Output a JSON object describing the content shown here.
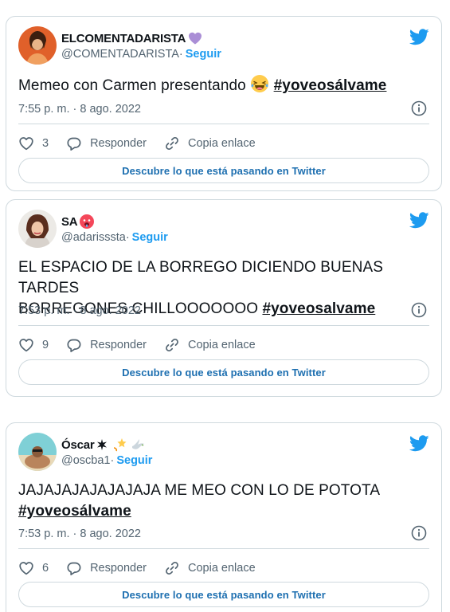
{
  "tweets": [
    {
      "display_name": "ELCOMENTADARISTA",
      "handle": "@COMENTADARISTA",
      "separator": " · ",
      "follow_label": "Seguir",
      "text": "Memeo con Carmen presentando ",
      "hashtag": "#yoveosálvame",
      "timestamp": "7:55 p. m. · 8 ago. 2022",
      "likes": "3",
      "reply_label": "Responder",
      "copy_label": "Copia enlace",
      "discover_label": "Descubre lo que está pasando en Twitter"
    },
    {
      "display_name": "SA",
      "handle": "@adarisssta",
      "separator": " · ",
      "follow_label": "Seguir",
      "text_line1": "EL ESPACIO DE LA BORREGO DICIENDO BUENAS TARDES",
      "text_line2": "BORREGONES CHILLOOOOOOO ",
      "hashtag": "#yoveosalvame",
      "timestamp": "7:53 p. m. · 8 ago. 2022",
      "likes": "9",
      "reply_label": "Responder",
      "copy_label": "Copia enlace",
      "discover_label": "Descubre lo que está pasando en Twitter"
    },
    {
      "display_name": "Óscar",
      "handle": "@oscba1",
      "separator": " · ",
      "follow_label": "Seguir",
      "text_line1": "JAJAJAJAJAJAJAJA ME MEO CON LO DE POTOTA",
      "hashtag": "#yoveosálvame",
      "timestamp": "7:53 p. m. · 8 ago. 2022",
      "likes": "6",
      "reply_label": "Responder",
      "copy_label": "Copia enlace",
      "discover_label": "Descubre lo que está pasando en Twitter"
    }
  ],
  "colors": {
    "twitter_blue": "#1d9bf0",
    "text_primary": "#0f1419",
    "text_secondary": "#536471",
    "border": "#cfd9de"
  },
  "icons": [
    "twitter-bird-icon",
    "info-icon",
    "heart-icon",
    "reply-icon",
    "link-icon",
    "purple-heart-emoji",
    "hot-face-emoji",
    "laughing-emoji",
    "sparkle-icon",
    "dizzy-emoji",
    "dove-emoji"
  ]
}
